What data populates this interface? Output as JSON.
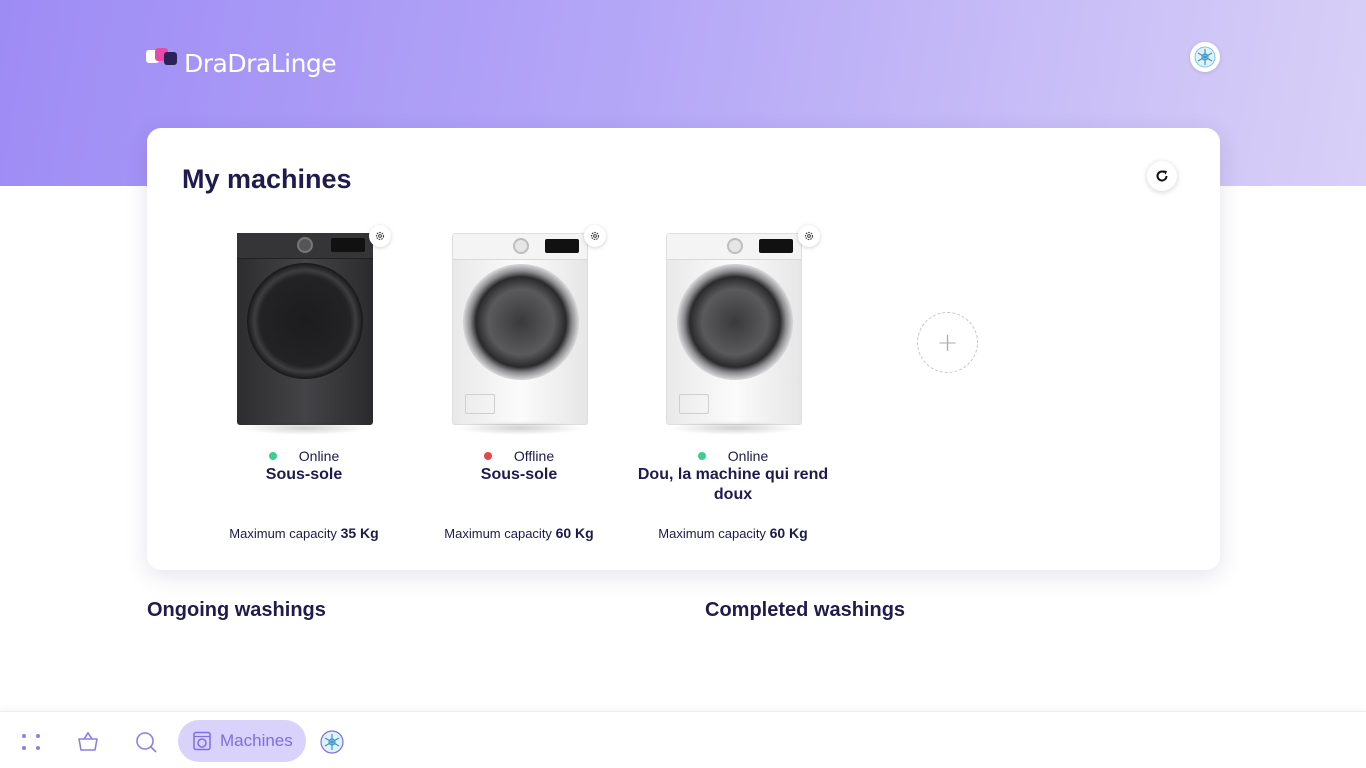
{
  "app": {
    "logo_text": "DraDraLinge"
  },
  "header": {
    "avatar_icon": "snowflake-avatar-icon"
  },
  "machines_card": {
    "title": "My machines",
    "refresh_icon": "refresh-icon",
    "capacity_prefix": "Maximum capacity",
    "machines": [
      {
        "status": "Online",
        "status_color": "#3ccf8e",
        "name": "Sous-sole",
        "capacity": "35 Kg",
        "color": "dark"
      },
      {
        "status": "Offline",
        "status_color": "#e0484b",
        "name": "Sous-sole",
        "capacity": "60 Kg",
        "color": "white"
      },
      {
        "status": "Online",
        "status_color": "#3ccf8e",
        "name": "Dou, la machine qui rend doux",
        "capacity": "60 Kg",
        "color": "white"
      }
    ],
    "add_label": "+"
  },
  "sections": {
    "ongoing": "Ongoing washings",
    "completed": "Completed washings"
  },
  "bottom_nav": {
    "items": [
      {
        "icon": "apps-grid-icon"
      },
      {
        "icon": "basket-icon"
      },
      {
        "icon": "search-icon"
      },
      {
        "icon": "washing-machine-icon",
        "label": "Machines",
        "active": true
      },
      {
        "icon": "snowflake-avatar-icon"
      }
    ],
    "active_label": "Machines"
  },
  "colors": {
    "accent": "#9e8cf5",
    "accent_light": "#d9d2fa",
    "text_dark": "#1f1c4d"
  }
}
